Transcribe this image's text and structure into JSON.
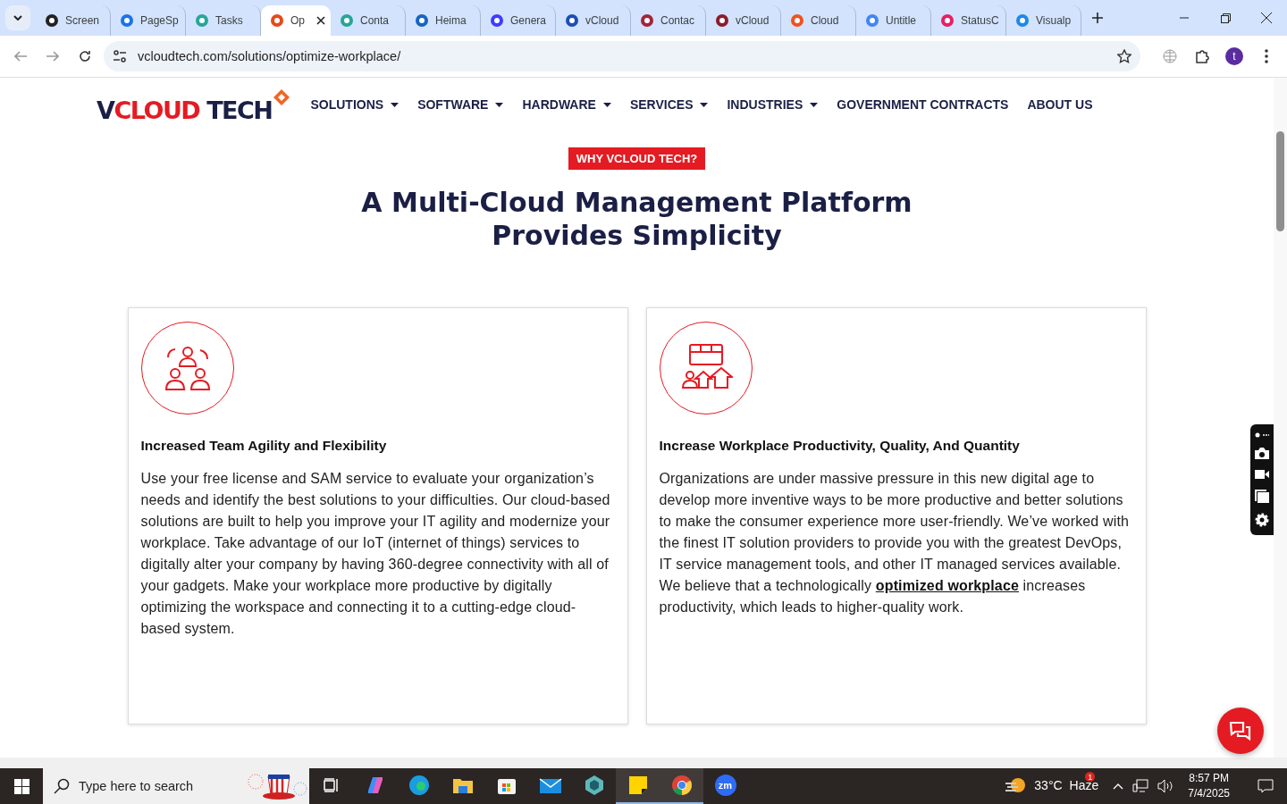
{
  "browser": {
    "tabs": [
      {
        "label": "Screen",
        "selected": false
      },
      {
        "label": "PageSp",
        "selected": false
      },
      {
        "label": "Tasks",
        "selected": false
      },
      {
        "label": "Op",
        "selected": true
      },
      {
        "label": "Conta",
        "selected": false
      },
      {
        "label": "Heima",
        "selected": false
      },
      {
        "label": "Genera",
        "selected": false
      },
      {
        "label": "vCloud",
        "selected": false
      },
      {
        "label": "Contac",
        "selected": false
      },
      {
        "label": "vCloud",
        "selected": false
      },
      {
        "label": "Cloud",
        "selected": false
      },
      {
        "label": "Untitle",
        "selected": false
      },
      {
        "label": "StatusC",
        "selected": false
      },
      {
        "label": "Visualp",
        "selected": false
      }
    ],
    "url": "vcloudtech.com/solutions/optimize-workplace/",
    "profile_initial": "t"
  },
  "site": {
    "logo": {
      "lead": "V",
      "highlight": "CLOUD",
      "tail": "TECH"
    },
    "nav": [
      {
        "label": "SOLUTIONS",
        "has_menu": true
      },
      {
        "label": "SOFTWARE",
        "has_menu": true
      },
      {
        "label": "HARDWARE",
        "has_menu": true
      },
      {
        "label": "SERVICES",
        "has_menu": true
      },
      {
        "label": "INDUSTRIES",
        "has_menu": true
      },
      {
        "label": "GOVERNMENT CONTRACTS",
        "has_menu": false
      },
      {
        "label": "ABOUT US",
        "has_menu": false
      }
    ],
    "badge": "WHY VCLOUD TECH?",
    "heading": [
      "A Multi-Cloud Management Platform",
      "Provides Simplicity"
    ],
    "cards": [
      {
        "kind": "team",
        "title": "Increased Team Agility and Flexibility",
        "body": "Use your free license and SAM service to evaluate your organization’s needs and identify the best solutions to your difficulties. Our cloud-based solutions are built to help you improve your IT agility and modernize your workplace. Take advantage of our IoT (internet of things) services to digitally alter your company by having 360-degree connectivity with all of your gadgets. Make your workplace more productive by digitally optimizing the workspace and connecting it to a cutting-edge cloud-based system."
      },
      {
        "kind": "growth",
        "title": "Increase Workplace Productivity, Quality, And Quantity",
        "body": "Organizations are under massive pressure in this new digital age to develop more inventive ways to be more productive and better solutions to make the consumer experience more user-friendly. We’ve worked with the finest IT solution providers to provide you with the greatest DevOps, IT service management tools, and other IT managed services available. We believe that a technologically",
        "link": "optimized workplace",
        "body_after": " increases productivity, which leads to higher-quality work."
      }
    ]
  },
  "taskbar": {
    "search_placeholder": "Type here to search",
    "apps": [
      {
        "kind": "taskview",
        "active": false
      },
      {
        "kind": "copilot",
        "active": false
      },
      {
        "kind": "edge",
        "active": false
      },
      {
        "kind": "files",
        "active": false
      },
      {
        "kind": "store",
        "active": false
      },
      {
        "kind": "mail",
        "active": false
      },
      {
        "kind": "cube",
        "active": false
      },
      {
        "kind": "notes",
        "active": true
      },
      {
        "kind": "chrome",
        "active": true
      },
      {
        "kind": "zoom",
        "active": false
      }
    ],
    "zoom_label": "zm",
    "weather_badge": "1",
    "temperature": "33°C",
    "weather": "Haze",
    "time": "8:57 PM",
    "date": "7/4/2025"
  }
}
